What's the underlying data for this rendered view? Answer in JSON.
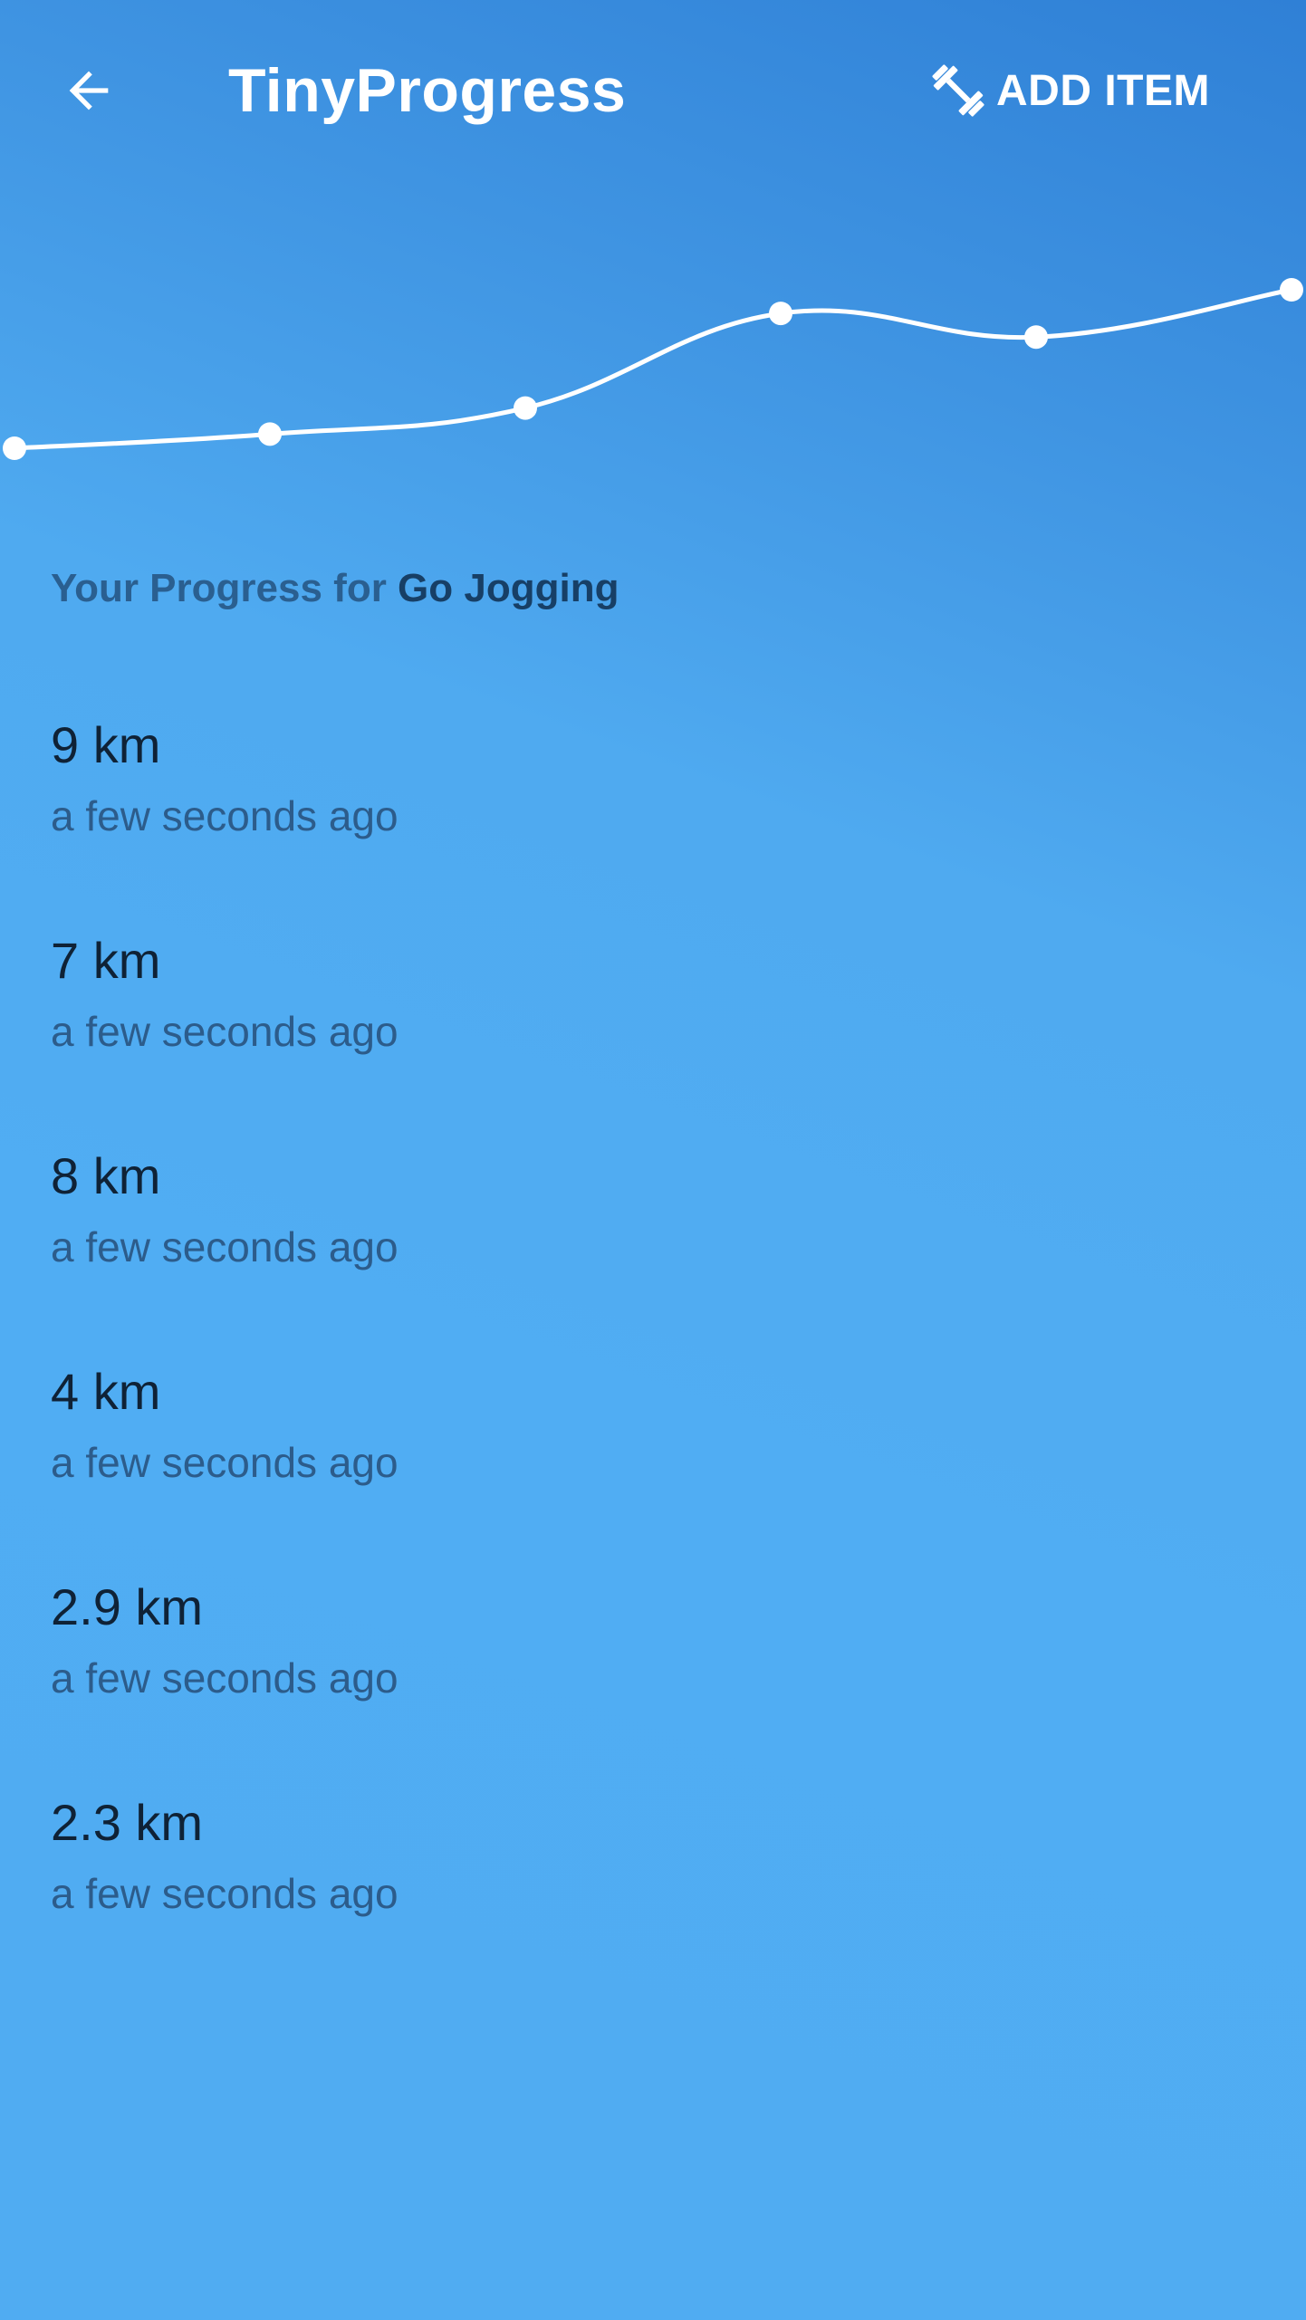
{
  "app_bar": {
    "title": "TinyProgress",
    "back_icon": "arrow-back-icon",
    "add_item_icon": "dumbbell-icon",
    "add_item_label": "ADD ITEM"
  },
  "colors": {
    "background_top": "#2f80d6",
    "background_bottom": "#50acf2",
    "text_primary": "#0f2236",
    "text_secondary": "#2c5c8b",
    "heading": "#1f5486",
    "white": "#ffffff"
  },
  "heading": {
    "prefix": "Your Progress for ",
    "habit": "Go Jogging"
  },
  "entries": [
    {
      "value": "9 km",
      "time": "a few seconds ago"
    },
    {
      "value": "7 km",
      "time": "a few seconds ago"
    },
    {
      "value": "8 km",
      "time": "a few seconds ago"
    },
    {
      "value": "4 km",
      "time": "a few seconds ago"
    },
    {
      "value": "2.9 km",
      "time": "a few seconds ago"
    },
    {
      "value": "2.3 km",
      "time": "a few seconds ago"
    }
  ],
  "chart_data": {
    "type": "line",
    "smooth": true,
    "x": [
      1,
      2,
      3,
      4,
      5,
      6
    ],
    "values": [
      2.3,
      2.9,
      4,
      8,
      7,
      9
    ],
    "axes_visible": false,
    "grid": false,
    "legend": "none",
    "line_color": "#ffffff"
  }
}
